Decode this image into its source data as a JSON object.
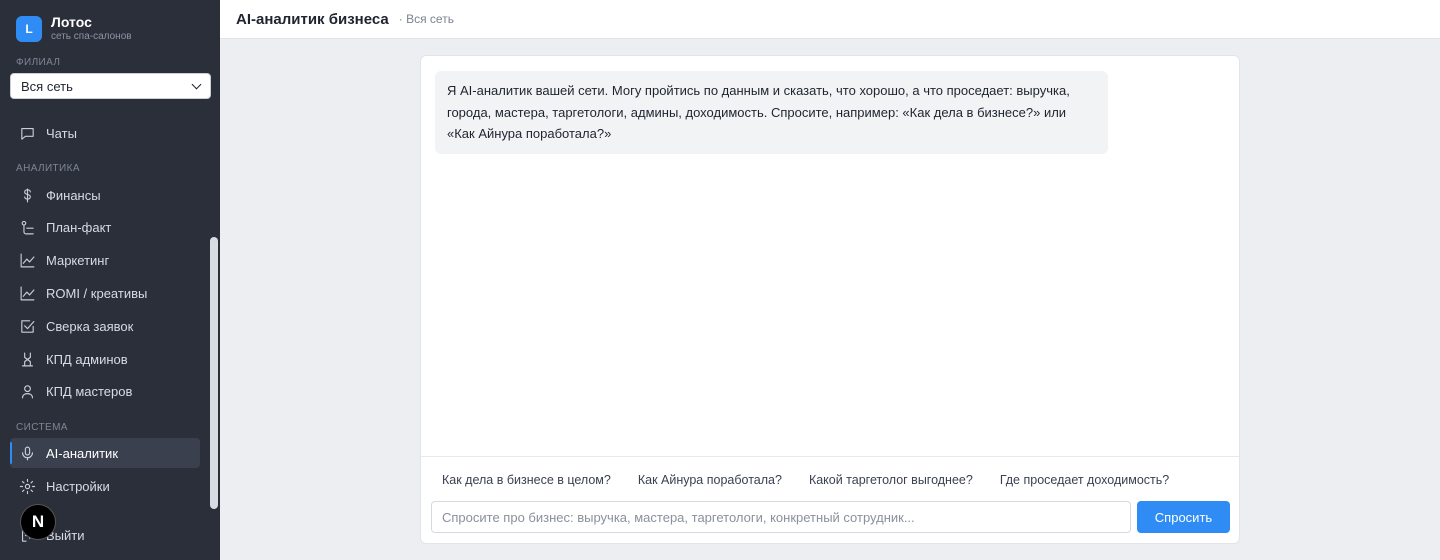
{
  "brand": {
    "logo_letter": "L",
    "name": "Лотос",
    "subtitle": "сеть спа-салонов"
  },
  "branch": {
    "label": "Филиал",
    "selected": "Вся сеть"
  },
  "sidebar": {
    "top_items": [
      {
        "label": "Чаты",
        "icon": "chat-icon"
      }
    ],
    "analytics_label": "Аналитика",
    "analytics_items": [
      {
        "label": "Финансы",
        "icon": "dollar-icon"
      },
      {
        "label": "План-факт",
        "icon": "plan-icon"
      },
      {
        "label": "Маркетинг",
        "icon": "chart-line-icon"
      },
      {
        "label": "ROMI / креативы",
        "icon": "chart-line-icon"
      },
      {
        "label": "Сверка заявок",
        "icon": "checkbox-icon"
      },
      {
        "label": "КПД админов",
        "icon": "hourglass-icon"
      },
      {
        "label": "КПД мастеров",
        "icon": "user-icon"
      }
    ],
    "system_label": "Система",
    "system_items": [
      {
        "label": "AI-аналитик",
        "icon": "microphone-icon",
        "active": true
      },
      {
        "label": "Настройки",
        "icon": "gear-icon"
      },
      {
        "label": "Выйти",
        "icon": "logout-icon"
      }
    ]
  },
  "overlay_badge": "N",
  "header": {
    "title": "AI-аналитик бизнеса",
    "breadcrumb": "· Вся сеть"
  },
  "chat": {
    "welcome": "Я AI-аналитик вашей сети. Могу пройтись по данным и сказать, что хорошо, а что проседает: выручка, города, мастера, таргетологи, админы, доходимость. Спросите, например: «Как дела в бизнесе?» или «Как Айнура поработала?»",
    "suggestions": [
      "Как дела в бизнесе в целом?",
      "Как Айнура поработала?",
      "Какой таргетолог выгоднее?",
      "Где проседает доходимость?"
    ],
    "input_placeholder": "Спросите про бизнес: выручка, мастера, таргетологи, конкретный сотрудник...",
    "input_value": "",
    "send_label": "Спросить"
  },
  "colors": {
    "sidebar_bg": "#2a2f3a",
    "accent": "#2f8cf5",
    "page_bg": "#eceef2"
  }
}
